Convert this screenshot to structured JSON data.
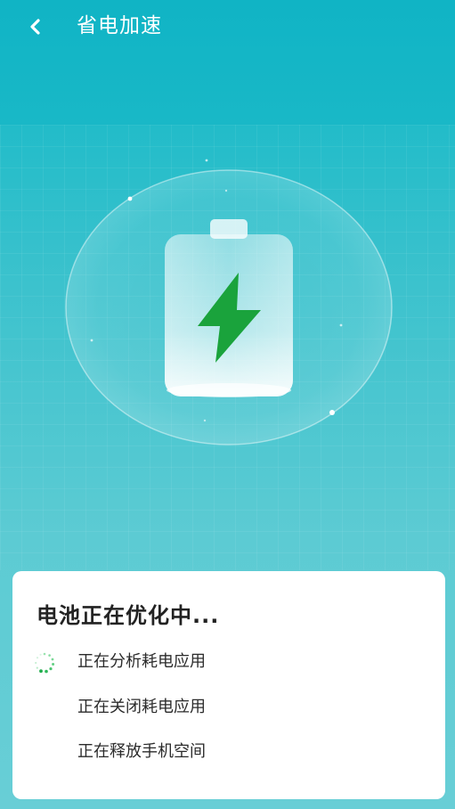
{
  "header": {
    "back_icon": "chevron-left-icon",
    "title": "省电加速"
  },
  "hero": {
    "icon": "battery-charging-icon",
    "bolt_color": "#1aa33c"
  },
  "status_card": {
    "title": "电池正在优化中...",
    "steps": [
      {
        "label": "正在分析耗电应用",
        "state": "in-progress"
      },
      {
        "label": "正在关闭耗电应用",
        "state": "pending"
      },
      {
        "label": "正在释放手机空间",
        "state": "pending"
      }
    ]
  },
  "colors": {
    "header_bg": "#10b4c5",
    "accent_green": "#1aa33c",
    "card_bg": "#ffffff"
  }
}
